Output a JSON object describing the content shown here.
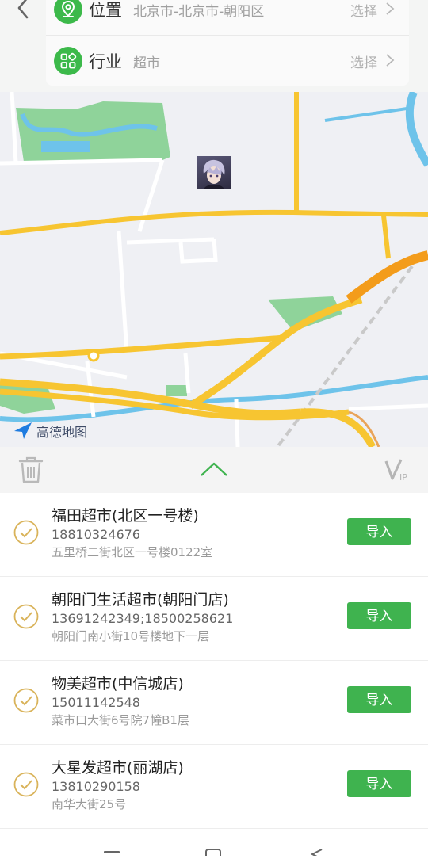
{
  "header": {
    "location": {
      "label": "位置",
      "value": "北京市-北京市-朝阳区",
      "action": "选择"
    },
    "industry": {
      "label": "行业",
      "value": "超市",
      "action": "选择"
    }
  },
  "map": {
    "provider_logo": "高德地图"
  },
  "toolbar": {
    "vip_label": "VIP"
  },
  "import_label": "导入",
  "stores": [
    {
      "name": "福田超市(北区一号楼)",
      "phone": "18810324676",
      "address": "五里桥二街北区一号楼0122室"
    },
    {
      "name": "朝阳门生活超市(朝阳门店)",
      "phone": "13691242349;18500258621",
      "address": "朝阳门南小街10号楼地下一层"
    },
    {
      "name": "物美超市(中信城店)",
      "phone": "15011142548",
      "address": "菜市口大街6号院7幢B1层"
    },
    {
      "name": "大星发超市(丽湖店)",
      "phone": "13810290158",
      "address": "南华大街25号"
    }
  ],
  "colors": {
    "accent_green": "#3fb34f",
    "check_gold": "#d9b35a",
    "road_yellow": "#f7c531",
    "highway_orange": "#f39c1b"
  }
}
